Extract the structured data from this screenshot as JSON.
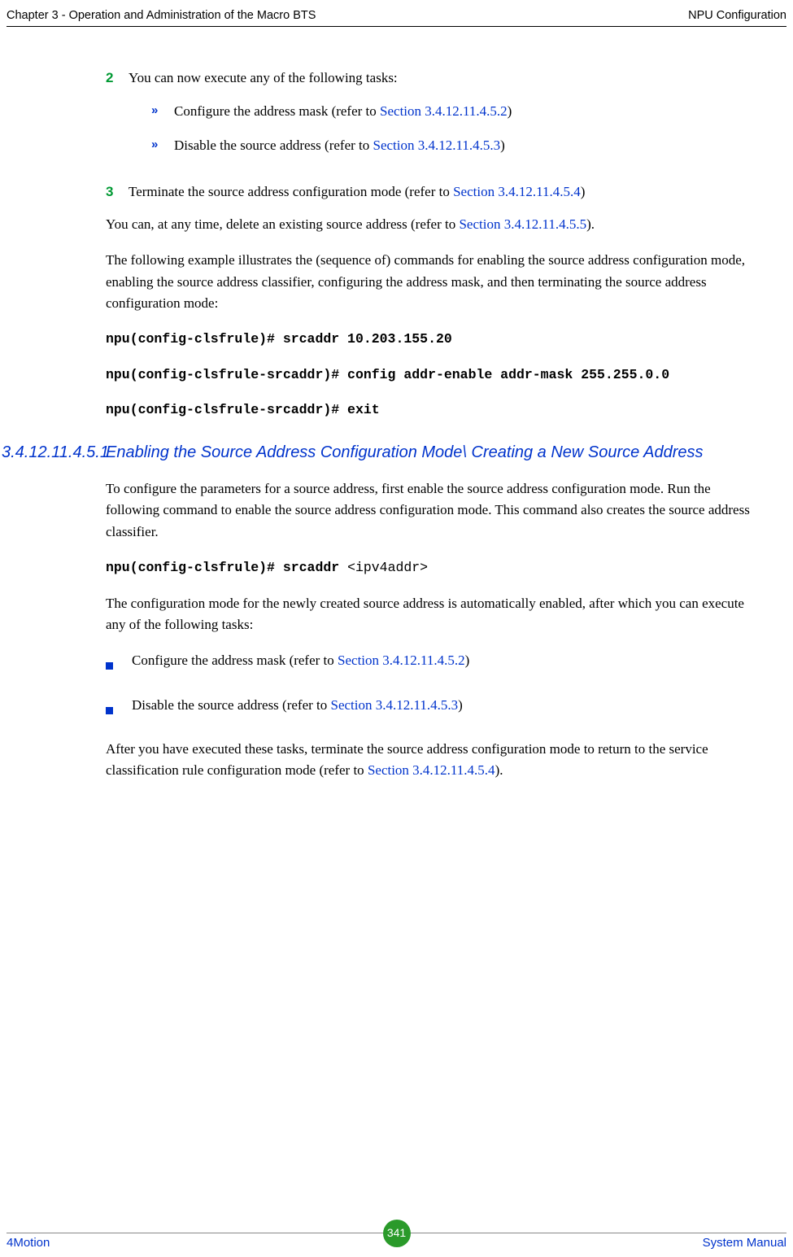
{
  "header": {
    "left": "Chapter 3 - Operation and Administration of the Macro BTS",
    "right": "NPU Configuration"
  },
  "step2": {
    "num": "2",
    "text": "You can now execute any of the following tasks:",
    "sub1_pre": "Configure the address mask (refer to ",
    "sub1_link": "Section 3.4.12.11.4.5.2",
    "sub1_post": ")",
    "sub2_pre": "Disable the source address (refer to ",
    "sub2_link": "Section 3.4.12.11.4.5.3",
    "sub2_post": ")"
  },
  "step3": {
    "num": "3",
    "pre": "Terminate the source address configuration mode (refer to ",
    "link": "Section 3.4.12.11.4.5.4",
    "post": ")"
  },
  "para1": {
    "pre": "You can, at any time, delete an existing source address (refer to ",
    "link": "Section 3.4.12.11.4.5.5",
    "post": ")."
  },
  "para2": "The following example illustrates the (sequence of) commands for enabling the source address configuration mode, enabling the source address classifier, configuring the address mask, and then terminating the source address configuration mode:",
  "code1": "npu(config-clsfrule)# srcaddr 10.203.155.20",
  "code2": "npu(config-clsfrule-srcaddr)# config addr-enable addr-mask 255.255.0.0",
  "code3": "npu(config-clsfrule-srcaddr)# exit",
  "section": {
    "num": "3.4.12.11.4.5.1",
    "title": "Enabling the Source Address Configuration Mode\\ Creating a New Source Address"
  },
  "para3": "To configure the parameters for a source address, first enable the source address configuration mode. Run the following command to enable the source address configuration mode. This command also creates the source address classifier.",
  "code4": {
    "cmd": "npu(config-clsfrule)# srcaddr ",
    "arg": "<ipv4addr>"
  },
  "para4": "The configuration mode for the newly created source address is automatically enabled, after which you can execute any of the following tasks:",
  "sq1": {
    "pre": "Configure the address mask (refer to ",
    "link": "Section 3.4.12.11.4.5.2",
    "post": ")"
  },
  "sq2": {
    "pre": "Disable the source address (refer to ",
    "link": "Section 3.4.12.11.4.5.3",
    "post": ")"
  },
  "para5": {
    "pre": "After you have executed these tasks, terminate the source address configuration mode to return to the service classification rule configuration mode (refer to ",
    "link": "Section 3.4.12.11.4.5.4",
    "post": ")."
  },
  "footer": {
    "left": "4Motion",
    "page": "341",
    "right": "System Manual"
  }
}
